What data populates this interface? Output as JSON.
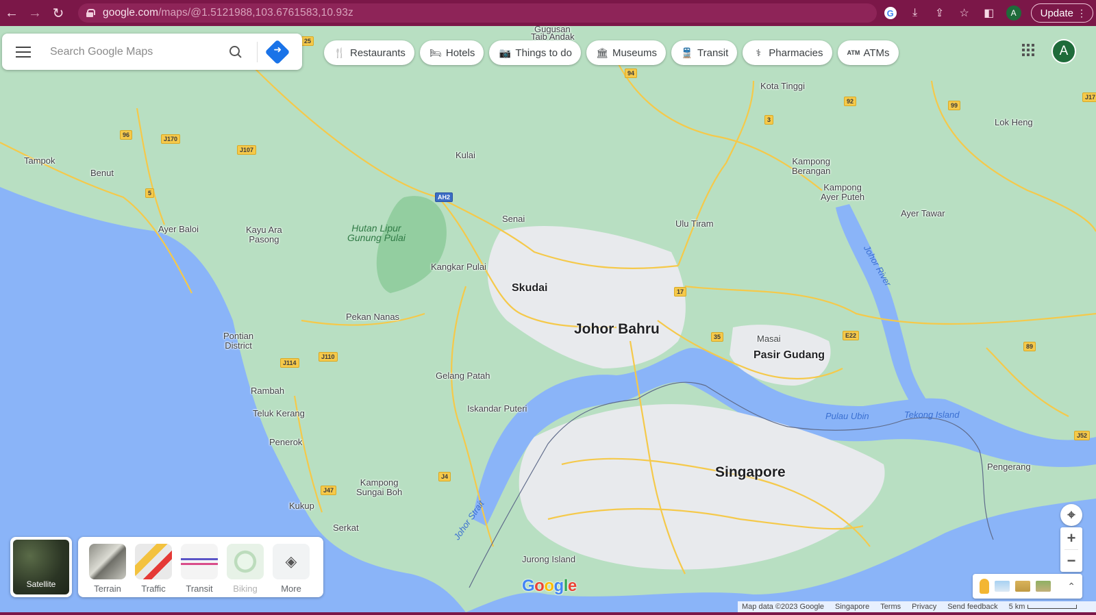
{
  "browser": {
    "url_domain": "google.com",
    "url_path": "/maps/@1.5121988,103.6761583,10.93z",
    "update_label": "Update",
    "profile_initial": "A"
  },
  "search": {
    "placeholder": "Search Google Maps"
  },
  "chips": [
    {
      "label": "Restaurants",
      "icon": "fork-knife-icon"
    },
    {
      "label": "Hotels",
      "icon": "bed-icon"
    },
    {
      "label": "Things to do",
      "icon": "camera-icon"
    },
    {
      "label": "Museums",
      "icon": "museum-icon"
    },
    {
      "label": "Transit",
      "icon": "train-icon"
    },
    {
      "label": "Pharmacies",
      "icon": "pharmacy-icon"
    },
    {
      "label": "ATMs",
      "icon": "atm-icon"
    }
  ],
  "account": {
    "initial": "A"
  },
  "map_labels": {
    "gugusan": "Gugusan",
    "taib_andak": "Taib Andak",
    "kota_tinggi": "Kota Tinggi",
    "lok_heng": "Lok Heng",
    "tampok": "Tampok",
    "benut": "Benut",
    "kulai": "Kulai",
    "kampong_berangan": "Kampong\nBerangan",
    "kampong_ayer_puteh": "Kampong\nAyer Puteh",
    "ayer_tawar": "Ayer Tawar",
    "senai": "Senai",
    "ulu_tiram": "Ulu Tiram",
    "ayer_baloi": "Ayer Baloi",
    "kayu_ara_pasong": "Kayu Ara\nPasong",
    "hutan_lipur": "Hutan Lipur\nGunung Pulai",
    "kangkar_pulai": "Kangkar Pulai",
    "skudai": "Skudai",
    "johor_river": "Johor River",
    "pekan_nanas": "Pekan Nanas",
    "johor_bahru": "Johor Bahru",
    "masai": "Masai",
    "pontian_district": "Pontian\nDistrict",
    "pasir_gudang": "Pasir Gudang",
    "gelang_patah": "Gelang Patah",
    "rambah": "Rambah",
    "iskandar_puteri": "Iskandar Puteri",
    "pulau_ubin": "Pulau Ubin",
    "tekong_island": "Tekong Island",
    "teluk_kerang": "Teluk Kerang",
    "penerok": "Penerok",
    "pengerang": "Pengerang",
    "singapore": "Singapore",
    "kampong_sungai_boh": "Kampong\nSungai Boh",
    "kukup": "Kukup",
    "johor_strait": "Johor Strait",
    "serkat": "Serkat",
    "jurong_island": "Jurong Island"
  },
  "shields": {
    "r25": "25",
    "r94": "94",
    "r92": "92",
    "r99": "99",
    "rJ17": "J17",
    "r96": "96",
    "rJ170": "J170",
    "rJ107": "J107",
    "r3": "3",
    "r5": "5",
    "rAH2": "AH2",
    "r17": "17",
    "r35": "35",
    "rE22": "E22",
    "r89": "89",
    "rJ114": "J114",
    "rJ110": "J110",
    "rJ52": "J52",
    "rJ4": "J4",
    "rJ47": "J47"
  },
  "layers": {
    "satellite": "Satellite",
    "items": [
      {
        "label": "Terrain"
      },
      {
        "label": "Traffic"
      },
      {
        "label": "Transit"
      },
      {
        "label": "Biking"
      },
      {
        "label": "More"
      }
    ]
  },
  "footer": {
    "map_data": "Map data ©2023 Google",
    "region": "Singapore",
    "terms": "Terms",
    "privacy": "Privacy",
    "feedback": "Send feedback",
    "scale": "5 km"
  },
  "google_logo": "Google",
  "colors": {
    "land": "#b8dfc2",
    "water": "#8ab4f8",
    "urban": "#e8eaed",
    "road": "#f5c94a",
    "chrome": "#7b1748"
  }
}
